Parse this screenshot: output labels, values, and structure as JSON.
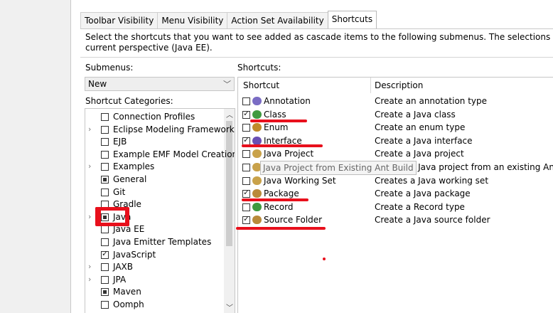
{
  "tabs": [
    "Toolbar Visibility",
    "Menu Visibility",
    "Action Set Availability",
    "Shortcuts"
  ],
  "description": {
    "line1": "Select the shortcuts that you want to see added as cascade items to the following submenus. The selections made will only a",
    "line2": "current perspective (Java EE)."
  },
  "submenus": {
    "label": "Submenus:",
    "selected": "New"
  },
  "categories": {
    "label": "Shortcut Categories:",
    "items": [
      {
        "label": "Connection Profiles",
        "expandable": false,
        "state": "unchecked"
      },
      {
        "label": "Eclipse Modeling Framework",
        "expandable": true,
        "state": "unchecked"
      },
      {
        "label": "EJB",
        "expandable": false,
        "state": "unchecked"
      },
      {
        "label": "Example EMF Model Creation",
        "expandable": false,
        "state": "unchecked"
      },
      {
        "label": "Examples",
        "expandable": true,
        "state": "unchecked"
      },
      {
        "label": "General",
        "expandable": false,
        "state": "partial"
      },
      {
        "label": "Git",
        "expandable": false,
        "state": "unchecked"
      },
      {
        "label": "Gradle",
        "expandable": false,
        "state": "unchecked"
      },
      {
        "label": "Java",
        "expandable": true,
        "state": "partial"
      },
      {
        "label": "Java EE",
        "expandable": false,
        "state": "unchecked"
      },
      {
        "label": "Java Emitter Templates",
        "expandable": false,
        "state": "unchecked"
      },
      {
        "label": "JavaScript",
        "expandable": false,
        "state": "checked"
      },
      {
        "label": "JAXB",
        "expandable": true,
        "state": "unchecked"
      },
      {
        "label": "JPA",
        "expandable": true,
        "state": "unchecked"
      },
      {
        "label": "Maven",
        "expandable": false,
        "state": "partial"
      },
      {
        "label": "Oomph",
        "expandable": false,
        "state": "unchecked"
      }
    ]
  },
  "shortcuts": {
    "label": "Shortcuts:",
    "columns": [
      "Shortcut",
      "Description"
    ],
    "rows": [
      {
        "label": "Annotation",
        "description": "Create an annotation type",
        "checked": false,
        "icon": "annotation-icon",
        "color": "#7a6cc4"
      },
      {
        "label": "Class",
        "description": "Create a Java class",
        "checked": true,
        "icon": "class-icon",
        "color": "#3f9a3f"
      },
      {
        "label": "Enum",
        "description": "Create an enum type",
        "checked": false,
        "icon": "enum-icon",
        "color": "#c08a2a"
      },
      {
        "label": "Interface",
        "description": "Create a Java interface",
        "checked": true,
        "icon": "interface-icon",
        "color": "#6a4fb3"
      },
      {
        "label": "Java Project",
        "description": "Create a Java project",
        "checked": false,
        "icon": "java-project-icon",
        "color": "#c9a24a"
      },
      {
        "label": "Java Project from Existing",
        "description": "Creates a Java project from an existing Ant build",
        "checked": false,
        "icon": "java-project-ant-icon",
        "color": "#c9a24a"
      },
      {
        "label": "Java Working Set",
        "description": "Creates a Java working set",
        "checked": false,
        "icon": "working-set-icon",
        "color": "#c9a24a"
      },
      {
        "label": "Package",
        "description": "Create a Java package",
        "checked": true,
        "icon": "package-icon",
        "color": "#b98a3a"
      },
      {
        "label": "Record",
        "description": "Create a Record type",
        "checked": false,
        "icon": "record-icon",
        "color": "#3f9a3f"
      },
      {
        "label": "Source Folder",
        "description": "Create a Java source folder",
        "checked": true,
        "icon": "source-folder-icon",
        "color": "#b98a3a"
      }
    ]
  },
  "tooltip_text": "Java Project from Existing Ant Build"
}
